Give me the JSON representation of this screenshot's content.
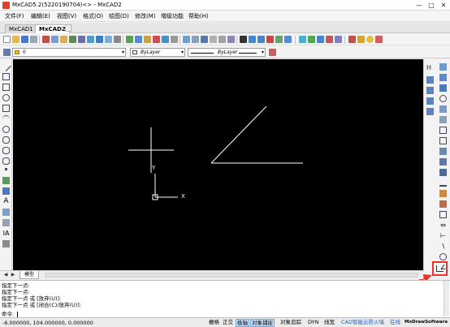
{
  "window": {
    "title": "MxCAD5.2(5220190704)<> - MxCAD2",
    "minimize": "—",
    "maximize": "□",
    "close": "✕"
  },
  "menu": [
    {
      "label": "文件(F)"
    },
    {
      "label": "编辑(E)"
    },
    {
      "label": "视图(V)"
    },
    {
      "label": "格式(O)"
    },
    {
      "label": "绘图(D)"
    },
    {
      "label": "修改(M)"
    },
    {
      "label": "増级功能"
    },
    {
      "label": "帮助(H)"
    }
  ],
  "doc_tabs": [
    {
      "label": "MxCAD1",
      "active": false
    },
    {
      "label": "MxCAD2",
      "active": true
    }
  ],
  "layer_combo": {
    "value": "0"
  },
  "color_combo": {
    "value": "ByLayer"
  },
  "linetype_combo": {
    "value": "ByLayer"
  },
  "canvas": {
    "ucs_y_label": "Y",
    "ucs_x_label": "X"
  },
  "model_tab": {
    "label": "模型"
  },
  "command_lines": [
    "指定下一点:",
    "指定下一点:",
    "指定下一点 或 [放弃(U)]:",
    "指定下一点 或 [闭合(C)/放弃(U)]:"
  ],
  "command_prompt": "命令:",
  "status": {
    "coordinates": "-6.000000,  104.000000,  0.000000",
    "buttons": [
      {
        "label": "栅格",
        "on": false
      },
      {
        "label": "正交",
        "on": false
      },
      {
        "label": "极轴",
        "on": true
      },
      {
        "label": "对象捕捉",
        "on": true
      },
      {
        "label": "对象追踪",
        "on": false
      },
      {
        "label": "DYN",
        "on": false
      },
      {
        "label": "线宽",
        "on": false
      }
    ],
    "link1": "CAD智能云防火墙",
    "link2": "在线",
    "brand": "MxDrawSoftware"
  }
}
